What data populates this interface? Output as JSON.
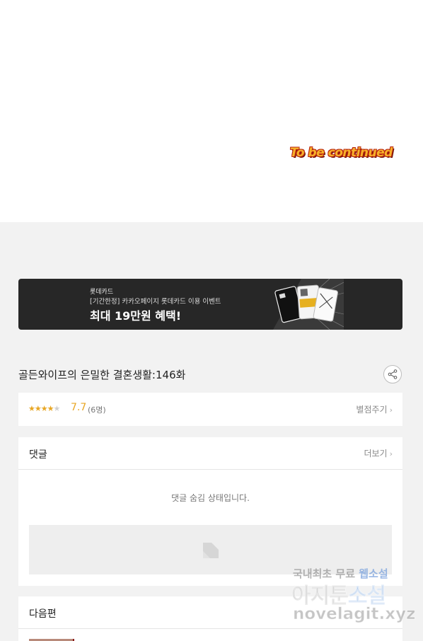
{
  "comic": {
    "end_text": "To be continued"
  },
  "banner": {
    "brand": "롯데카드",
    "subtitle": "[기간한정] 카카오페이지 롯데카드 이용 이벤트",
    "headline": "최대 19만원 혜택!"
  },
  "episode": {
    "title": "골든와이프의 은밀한 결혼생활:146화"
  },
  "rating": {
    "stars_filled": 4,
    "stars_total": 5,
    "score": "7.7",
    "votes": "(6명)",
    "rate_link": "별점주기"
  },
  "comments": {
    "header": "댓글",
    "more": "더보기",
    "hidden_message": "댓글 숨김 상태입니다."
  },
  "next_episode": {
    "header": "다음편"
  },
  "watermark": {
    "line1_a": "국내최초 무료 ",
    "line1_b": "웹소설",
    "line2_a": "아지툰",
    "line2_b": "소설",
    "line3": "novelagit.xyz"
  },
  "colors": {
    "accent_star": "#e8a623",
    "banner_bg": "#272727",
    "page_bg": "#f2f2f2"
  },
  "icons": [
    "share-icon",
    "chevron-right-icon",
    "image-placeholder-icon",
    "star-icon"
  ]
}
